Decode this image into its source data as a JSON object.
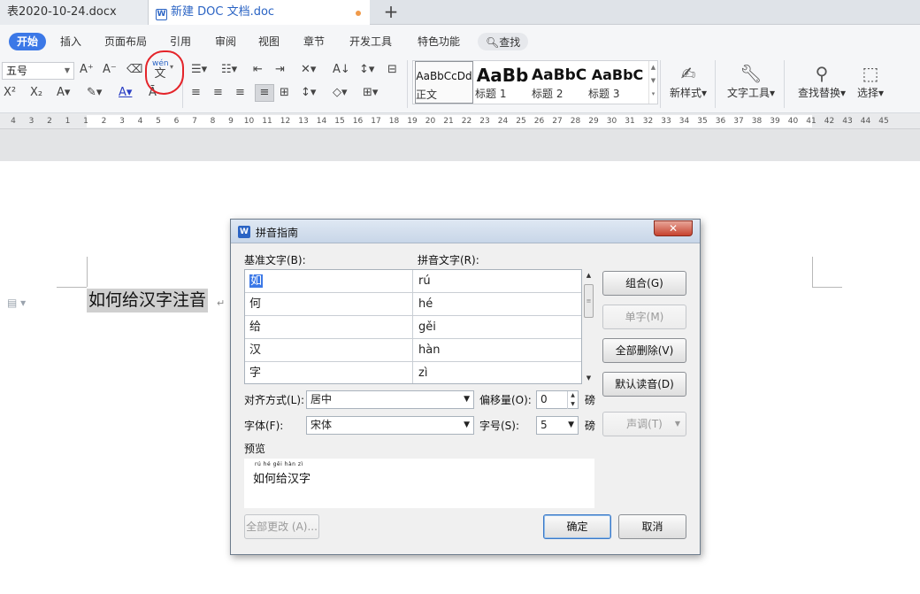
{
  "tabs": [
    {
      "label": "表2020-10-24.docx"
    },
    {
      "label": "新建 DOC 文档.doc",
      "icon": "W"
    }
  ],
  "menu": [
    "开始",
    "插入",
    "页面布局",
    "引用",
    "审阅",
    "视图",
    "章节",
    "开发工具",
    "特色功能",
    "查找"
  ],
  "ribbon": {
    "font_size": "五号",
    "pinyin_icon_top": "wén",
    "pinyin_icon_char": "文",
    "styles": [
      {
        "preview": "AaBbCcDd",
        "label": "正文"
      },
      {
        "preview": "AaBb",
        "label": "标题 1"
      },
      {
        "preview": "AaBbC",
        "label": "标题 2"
      },
      {
        "preview": "AaBbC",
        "label": "标题 3"
      }
    ],
    "new_style": "新样式",
    "text_tools": "文字工具",
    "find_replace": "查找替换",
    "select": "选择"
  },
  "ruler_numbers": [
    "4",
    "3",
    "2",
    "1",
    "1",
    "2",
    "3",
    "4",
    "5",
    "6",
    "7",
    "8",
    "9",
    "10",
    "11",
    "12",
    "13",
    "14",
    "15",
    "16",
    "17",
    "18",
    "19",
    "20",
    "21",
    "22",
    "23",
    "24",
    "25",
    "26",
    "27",
    "28",
    "29",
    "30",
    "31",
    "32",
    "33",
    "34",
    "35",
    "36",
    "37",
    "38",
    "39",
    "40",
    "41",
    "42",
    "43",
    "44",
    "45"
  ],
  "document": {
    "text": "如何给汉字注音"
  },
  "dialog": {
    "title": "拼音指南",
    "icon": "W",
    "base_text_label": "基准文字(B):",
    "ruby_text_label": "拼音文字(R):",
    "rows": [
      {
        "base": "如",
        "ruby": "rú"
      },
      {
        "base": "何",
        "ruby": "hé"
      },
      {
        "base": "给",
        "ruby": "gěi"
      },
      {
        "base": "汉",
        "ruby": "hàn"
      },
      {
        "base": "字",
        "ruby": "zì"
      }
    ],
    "buttons": {
      "group": "组合(G)",
      "single": "单字(M)",
      "clear_all": "全部删除(V)",
      "default_reading": "默认读音(D)",
      "tone": "声调(T)",
      "change_all": "全部更改 (A)...",
      "ok": "确定",
      "cancel": "取消"
    },
    "align_label": "对齐方式(L):",
    "align_value": "居中",
    "offset_label": "偏移量(O):",
    "offset_value": "0",
    "font_label": "字体(F):",
    "font_value": "宋体",
    "size_label": "字号(S):",
    "size_value": "5",
    "unit": "磅",
    "preview_label": "预览",
    "preview_pinyin": "rú hé gěi hàn zì",
    "preview_text": "如何给汉字"
  }
}
